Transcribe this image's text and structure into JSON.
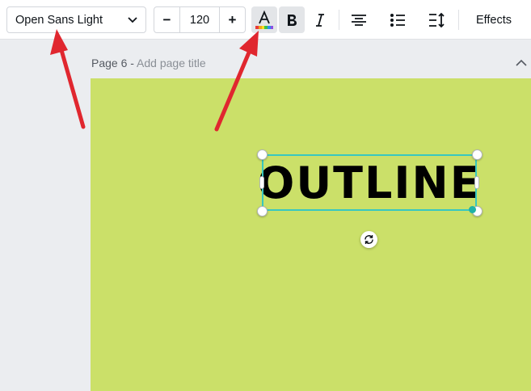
{
  "toolbar": {
    "font_name": "Open Sans Light",
    "size_decrease": "−",
    "font_size": "120",
    "size_increase": "+",
    "effects_label": "Effects",
    "icons": [
      "text-color-icon",
      "bold-icon",
      "italic-icon",
      "align-center-icon",
      "list-icon",
      "spacing-icon"
    ],
    "text_color_rainbow": [
      "#e83a3a",
      "#f2a31c",
      "#f5e020",
      "#3bc24a",
      "#2f8ff0",
      "#8c4fe0"
    ]
  },
  "page": {
    "number_label": "Page 6 - ",
    "title_placeholder": "Add page title"
  },
  "canvas": {
    "background": "#cbe069",
    "text": "OUTLINE",
    "selection_color": "#38c7c0"
  },
  "annotations": {
    "arrow_color": "#e0272f"
  }
}
